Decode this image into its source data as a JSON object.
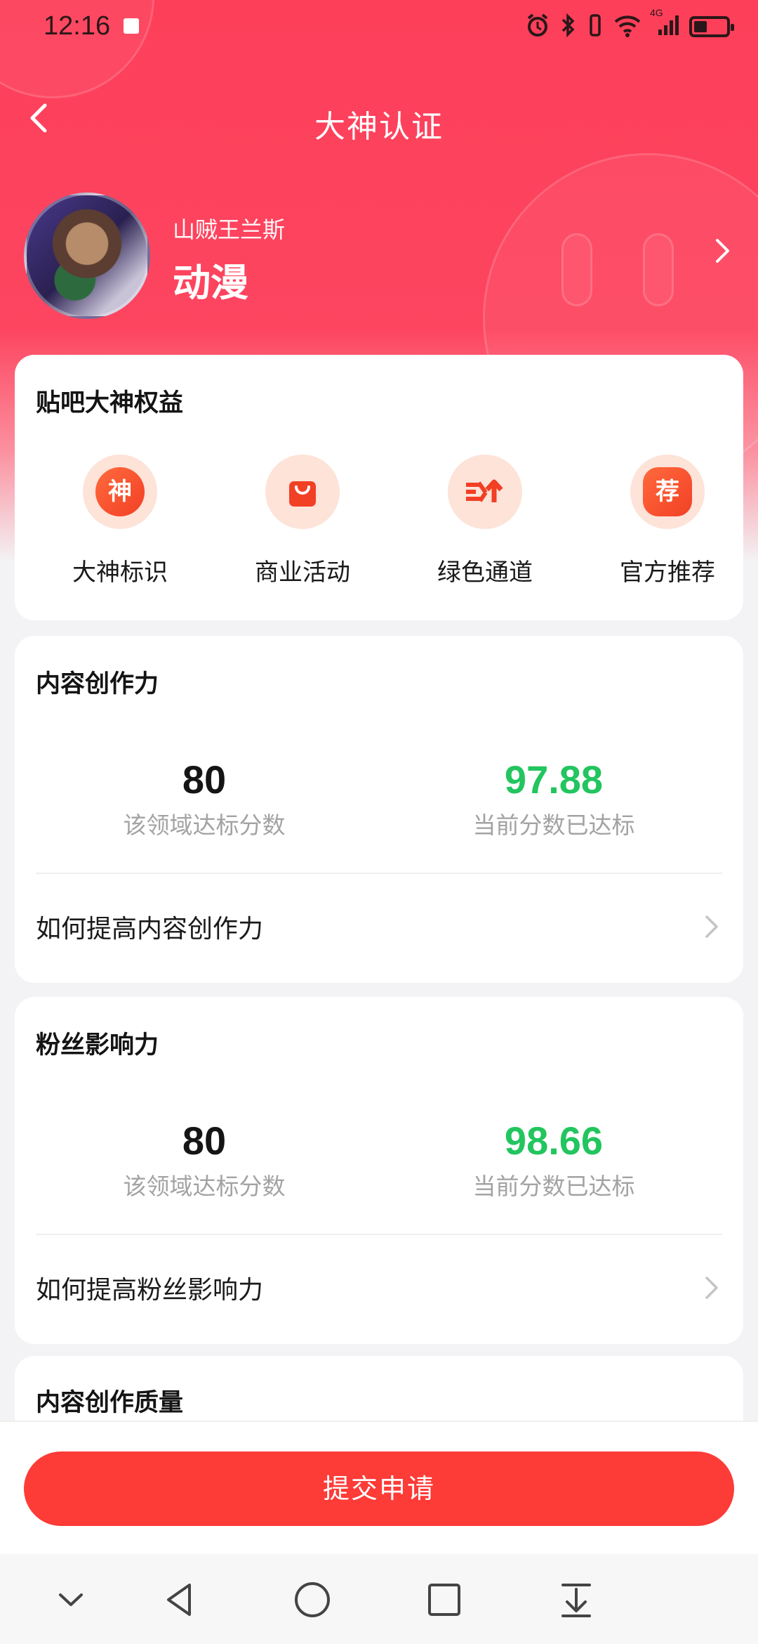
{
  "status_bar": {
    "time": "12:16",
    "network_label": "4G"
  },
  "nav": {
    "title": "大神认证"
  },
  "profile": {
    "username": "山贼王兰斯",
    "forum": "动漫"
  },
  "benefits": {
    "title": "贴吧大神权益",
    "items": [
      {
        "label": "大神标识",
        "icon_text": "神",
        "icon": "shen-badge-icon"
      },
      {
        "label": "商业活动",
        "icon_text": "",
        "icon": "shopping-bag-icon"
      },
      {
        "label": "绿色通道",
        "icon_text": "",
        "icon": "fast-lane-icon"
      },
      {
        "label": "官方推荐",
        "icon_text": "荐",
        "icon": "recommend-badge-icon"
      }
    ]
  },
  "content_power": {
    "title": "内容创作力",
    "target_score": "80",
    "target_label": "该领域达标分数",
    "current_score": "97.88",
    "current_label": "当前分数已达标",
    "link": "如何提高内容创作力"
  },
  "fan_influence": {
    "title": "粉丝影响力",
    "target_score": "80",
    "target_label": "该领域达标分数",
    "current_score": "98.66",
    "current_label": "当前分数已达标",
    "link": "如何提高粉丝影响力"
  },
  "content_quality": {
    "title": "内容创作质量"
  },
  "submit": {
    "label": "提交申请"
  },
  "colors": {
    "brand_red": "#fd3f5a",
    "button_red": "#fd3b37",
    "success_green": "#22c55e"
  }
}
